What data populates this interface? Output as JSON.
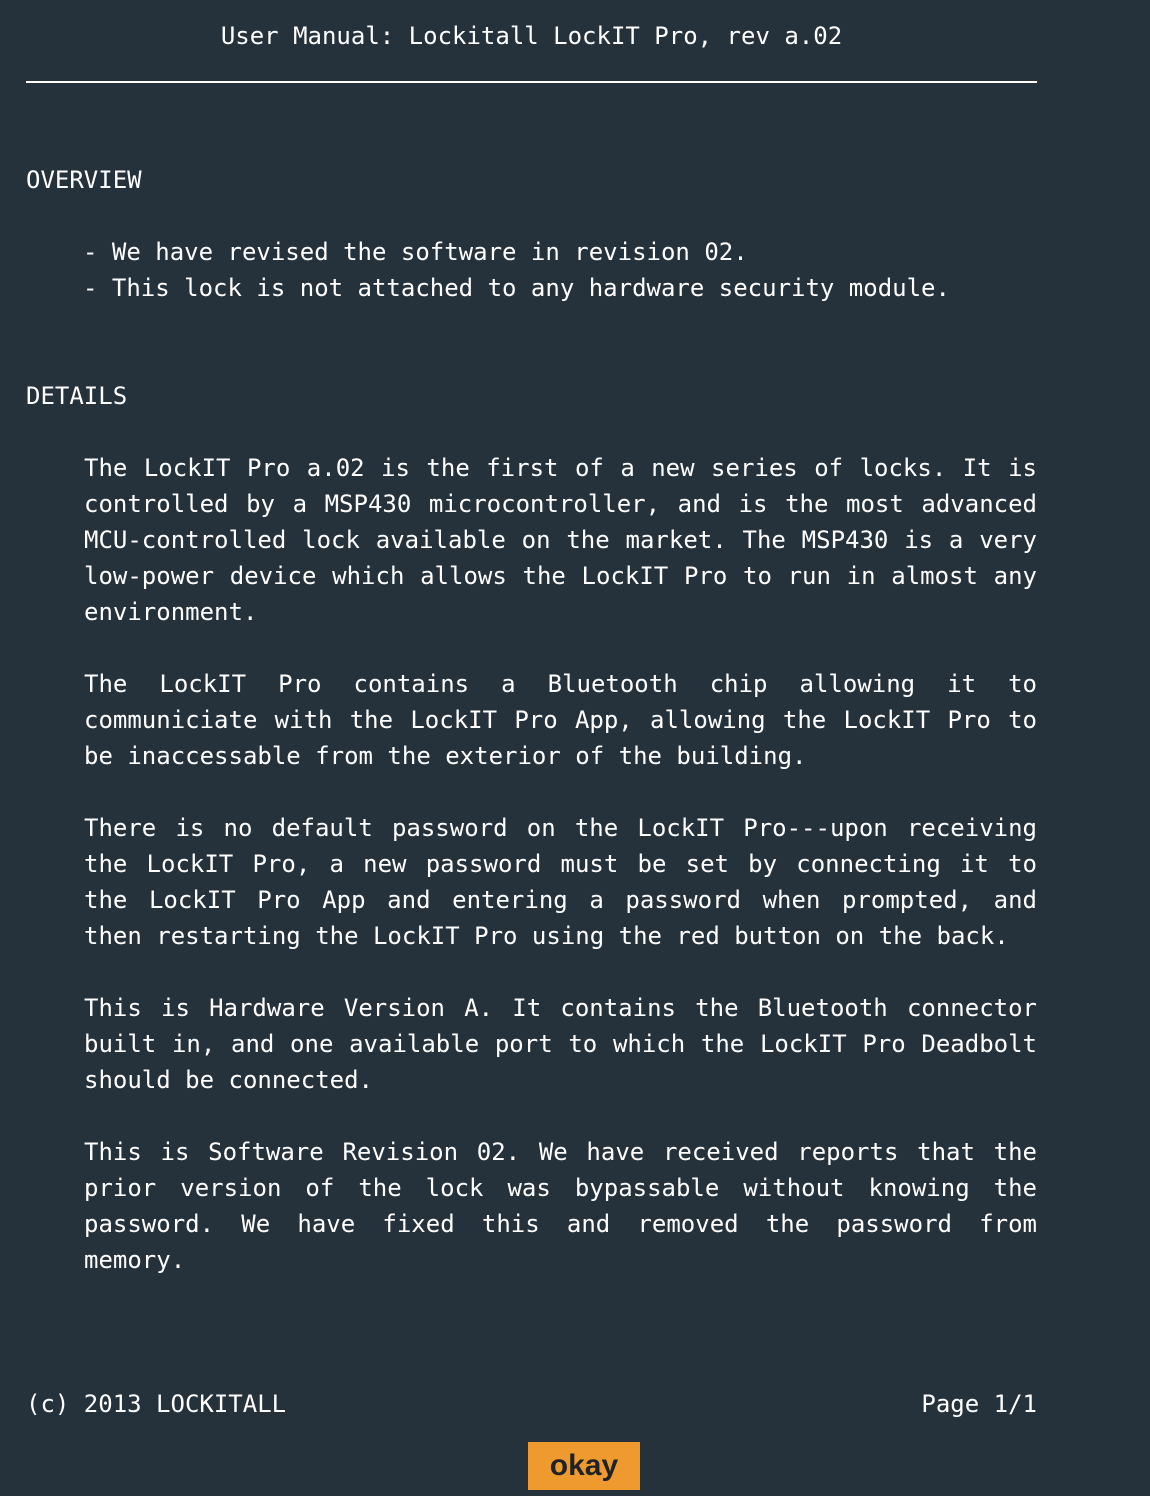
{
  "document": {
    "title": "User Manual: Lockitall LockIT Pro, rev a.02",
    "overview": {
      "heading": "OVERVIEW",
      "bullets": [
        "- We have revised the software in revision 02.",
        "- This lock is not attached to any hardware security module."
      ]
    },
    "details": {
      "heading": "DETAILS",
      "paragraphs": [
        "The LockIT Pro a.02  is the first of a new series  of locks. It is controlled by a  MSP430 microcontroller, and is  the most advanced MCU-controlled lock available on the  market. The MSP430 is a very low-power device which allows the LockIT  Pro to run in almost any environment.",
        "The  LockIT  Pro   contains  a  Bluetooth  chip   allowing  it  to communiciate with the  LockIT Pro App, allowing the  LockIT Pro to be inaccessable from the exterior of the building.",
        "There is  no default password  on the LockIT  Pro---upon receiving the LockIT Pro, a new password must be set by connecting it to the LockIT Pro  App and  entering a password  when prompted,  and then restarting the LockIT Pro using the red button on the back.",
        "This is Hardware  Version A.  It contains  the Bluetooth connector built in, and one available port  to which the LockIT Pro Deadbolt should be connected.",
        "This is  Software Revision 02.  We have received reports  that the prior  version of  the  lock was  bypassable  without knowing  the password. We have fixed this and removed the password from memory."
      ]
    },
    "footer": {
      "copyright": "(c) 2013 LOCKITALL",
      "page": "Page 1/1"
    }
  },
  "actions": {
    "okay_label": "okay"
  },
  "colors": {
    "background": "#26323b",
    "text": "#ffffff",
    "button_accent": "#ef9a2f"
  }
}
